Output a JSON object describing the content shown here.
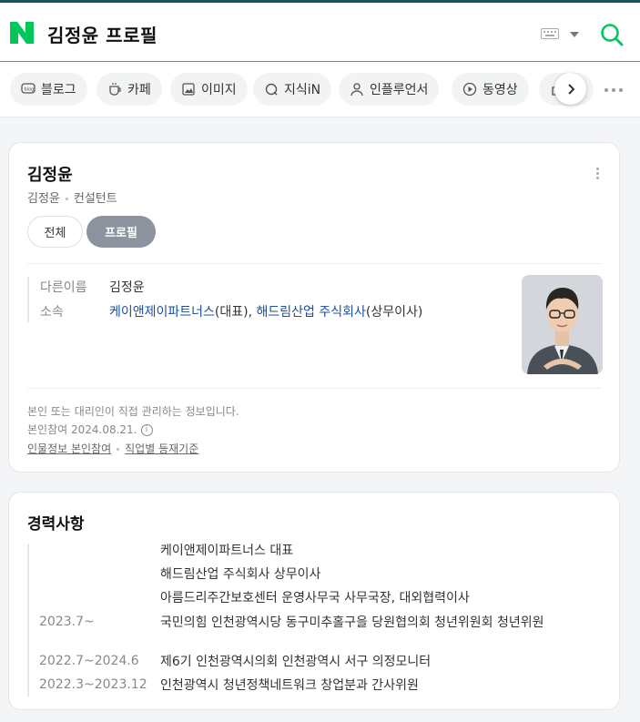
{
  "header": {
    "query": "김정윤 프로필"
  },
  "tabs": [
    {
      "label": "블로그",
      "icon": "blog-icon"
    },
    {
      "label": "카페",
      "icon": "cafe-icon"
    },
    {
      "label": "이미지",
      "icon": "image-icon"
    },
    {
      "label": "지식iN",
      "icon": "kin-icon"
    },
    {
      "label": "인플루언서",
      "icon": "person-icon"
    },
    {
      "label": "동영상",
      "icon": "video-icon"
    }
  ],
  "profile": {
    "name": "김정윤",
    "sub_name": "김정윤",
    "sub_job": "컨설턴트",
    "pill_all": "전체",
    "pill_profile": "프로필",
    "alias_label": "다른이름",
    "alias_value": "김정윤",
    "affil_label": "소속",
    "affil_link1": "케이앤제이파트너스",
    "affil_role1": "(대표), ",
    "affil_link2": "해드림산업 주식회사",
    "affil_role2": "(상무이사)",
    "note1": "본인 또는 대리인이 직접 관리하는 정보입니다.",
    "note2": "본인참여 2024.08.21.",
    "link_a": "인물정보 본인참여",
    "link_b": "직업별 등재기준"
  },
  "career": {
    "title": "경력사항",
    "items": [
      {
        "date": "",
        "text": "케이앤제이파트너스 대표"
      },
      {
        "date": "",
        "text": "해드림산업 주식회사 상무이사"
      },
      {
        "date": "",
        "text": "아름드리주간보호센터 운영사무국 사무국장, 대외협력이사"
      },
      {
        "date": "2023.7~",
        "text": "국민의힘 인천광역시당 동구미추홀구을 당원협의회 청년위원회 청년위원"
      },
      {
        "date": "2022.7~2024.6",
        "text": "제6기 인천광역시의회 인천광역시 서구 의정모니터"
      },
      {
        "date": "2022.3~2023.12",
        "text": "인천광역시 청년정책네트워크 창업분과 간사위원"
      }
    ]
  },
  "colors": {
    "brand": "#03c75a",
    "link": "#1a4fa3"
  }
}
